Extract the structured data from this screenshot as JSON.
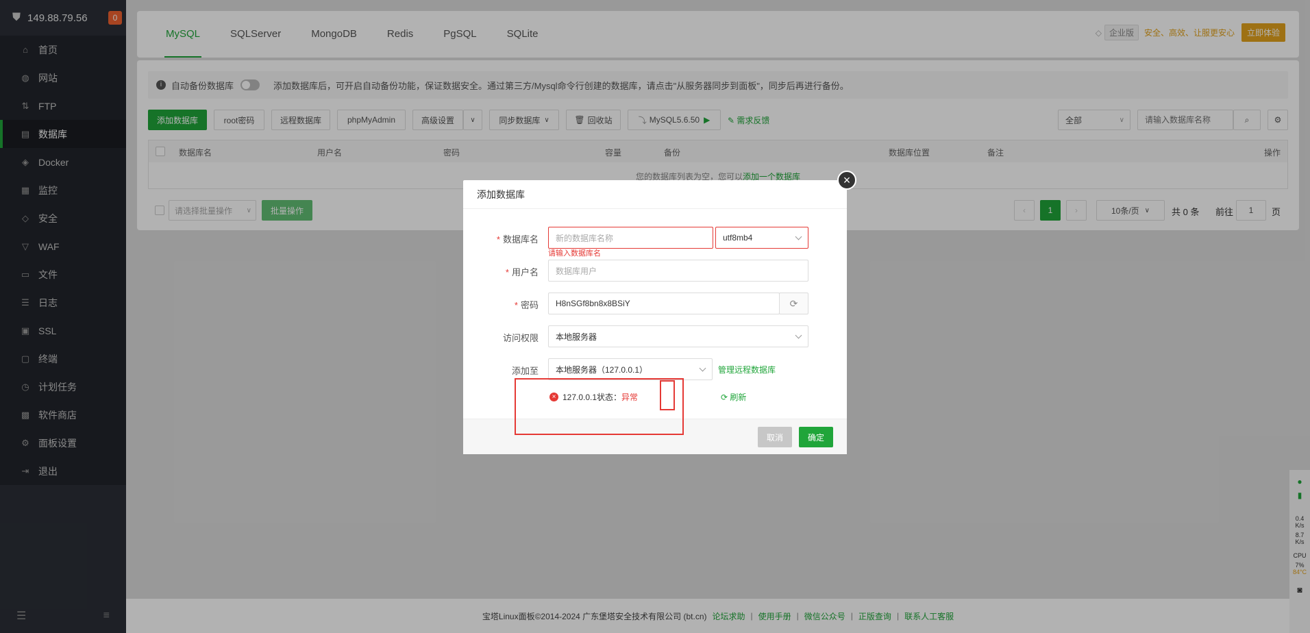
{
  "sidebar": {
    "ip": "149.88.79.56",
    "badge": "0",
    "items": [
      {
        "label": "首页",
        "icon": "home-icon"
      },
      {
        "label": "网站",
        "icon": "globe-icon"
      },
      {
        "label": "FTP",
        "icon": "ftp-icon"
      },
      {
        "label": "数据库",
        "icon": "database-icon"
      },
      {
        "label": "Docker",
        "icon": "docker-icon"
      },
      {
        "label": "监控",
        "icon": "monitor-icon"
      },
      {
        "label": "安全",
        "icon": "shield-icon"
      },
      {
        "label": "WAF",
        "icon": "waf-icon"
      },
      {
        "label": "文件",
        "icon": "folder-icon"
      },
      {
        "label": "日志",
        "icon": "log-icon"
      },
      {
        "label": "SSL",
        "icon": "ssl-icon"
      },
      {
        "label": "终端",
        "icon": "terminal-icon"
      },
      {
        "label": "计划任务",
        "icon": "clock-icon"
      },
      {
        "label": "软件商店",
        "icon": "store-icon"
      },
      {
        "label": "面板设置",
        "icon": "gear-icon"
      },
      {
        "label": "退出",
        "icon": "logout-icon"
      }
    ]
  },
  "tabs": [
    "MySQL",
    "SQLServer",
    "MongoDB",
    "Redis",
    "PgSQL",
    "SQLite"
  ],
  "enterprise": {
    "tag": "企业版",
    "slogan": "安全、高效、让服更安心",
    "try": "立即体验"
  },
  "notice": {
    "toggle_label": "自动备份数据库",
    "text": "添加数据库后，可开启自动备份功能，保证数据安全。通过第三方/Mysql命令行创建的数据库，请点击\"从服务器同步到面板\"，同步后再进行备份。"
  },
  "toolbar": {
    "add": "添加数据库",
    "root": "root密码",
    "remote": "远程数据库",
    "pma": "phpMyAdmin",
    "advanced": "高级设置",
    "sync": "同步数据库",
    "recycle": "回收站",
    "version": "MySQL5.6.50",
    "feedback": "需求反馈",
    "filter": "全部",
    "search_placeholder": "请输入数据库名称"
  },
  "table": {
    "headers": {
      "name": "数据库名",
      "user": "用户名",
      "password": "密码",
      "capacity": "容量",
      "backup": "备份",
      "location": "数据库位置",
      "note": "备注",
      "ops": "操作"
    },
    "empty_text": "您的数据库列表为空，您可以",
    "empty_link": "添加一个数据库"
  },
  "batch": {
    "placeholder": "请选择批量操作",
    "button": "批量操作"
  },
  "pager": {
    "current": "1",
    "per_page": "10条/页",
    "total": "共 0 条",
    "goto_label": "前往",
    "goto_value": "1",
    "page_unit": "页"
  },
  "footer": {
    "copyright": "宝塔Linux面板©2014-2024 广东堡塔安全技术有限公司 (bt.cn)",
    "links": [
      "论坛求助",
      "使用手册",
      "微信公众号",
      "正版查询",
      "联系人工客服"
    ]
  },
  "dialog": {
    "title": "添加数据库",
    "name_label": "数据库名",
    "name_placeholder": "新的数据库名称",
    "charset": "utf8mb4",
    "name_error": "请输入数据库名",
    "user_label": "用户名",
    "user_placeholder": "数据库用户",
    "pass_label": "密码",
    "pass_value": "H8nSGf8bn8x8BSiY",
    "access_label": "访问权限",
    "access_value": "本地服务器",
    "addto_label": "添加至",
    "addto_value": "本地服务器（127.0.0.1）",
    "manage_remote": "管理远程数据库",
    "status_prefix": "127.0.0.1状态：",
    "status_value": "异常",
    "refresh": "刷新",
    "cancel": "取消",
    "confirm": "确定"
  },
  "widget": {
    "net_up": "0.4",
    "net_up_unit": "K/s",
    "net_down": "8.7",
    "net_down_unit": "K/s",
    "cpu_label": "CPU",
    "cpu_value": "7",
    "cpu_unit": "%",
    "temp": "84°C"
  },
  "colors": {
    "accent": "#20a53a",
    "danger": "#e53935",
    "gold": "#e3a31e"
  }
}
